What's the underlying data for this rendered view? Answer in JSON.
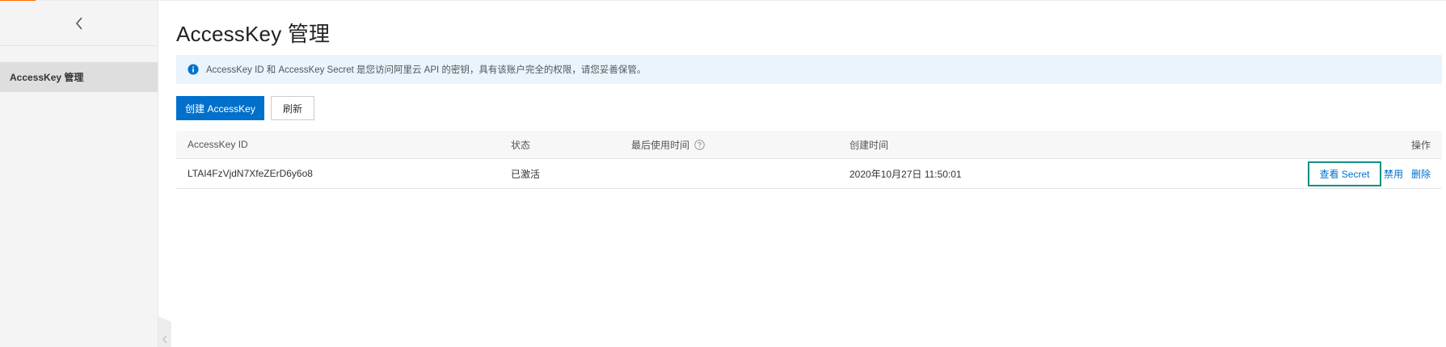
{
  "sidebar": {
    "items": [
      {
        "label": "AccessKey 管理"
      }
    ]
  },
  "page": {
    "title": "AccessKey 管理"
  },
  "notice": {
    "text": "AccessKey ID 和 AccessKey Secret 是您访问阿里云 API 的密钥，具有该账户完全的权限，请您妥善保管。"
  },
  "toolbar": {
    "create_label": "创建 AccessKey",
    "refresh_label": "刷新"
  },
  "table": {
    "columns": {
      "id": "AccessKey ID",
      "status": "状态",
      "last_used": "最后使用时间",
      "created": "创建时间",
      "actions": "操作"
    },
    "rows": [
      {
        "id": "LTAI4FzVjdN7XfeZErD6y6o8",
        "status": "已激活",
        "last_used": "",
        "created": "2020年10月27日 11:50:01",
        "actions": {
          "view_secret": "查看 Secret",
          "disable": "禁用",
          "delete": "删除"
        }
      }
    ]
  },
  "colors": {
    "primary": "#0070cc",
    "accent": "#ff6a00",
    "notice_bg": "#e9f4fd",
    "highlight_border": "#0e8f86"
  }
}
